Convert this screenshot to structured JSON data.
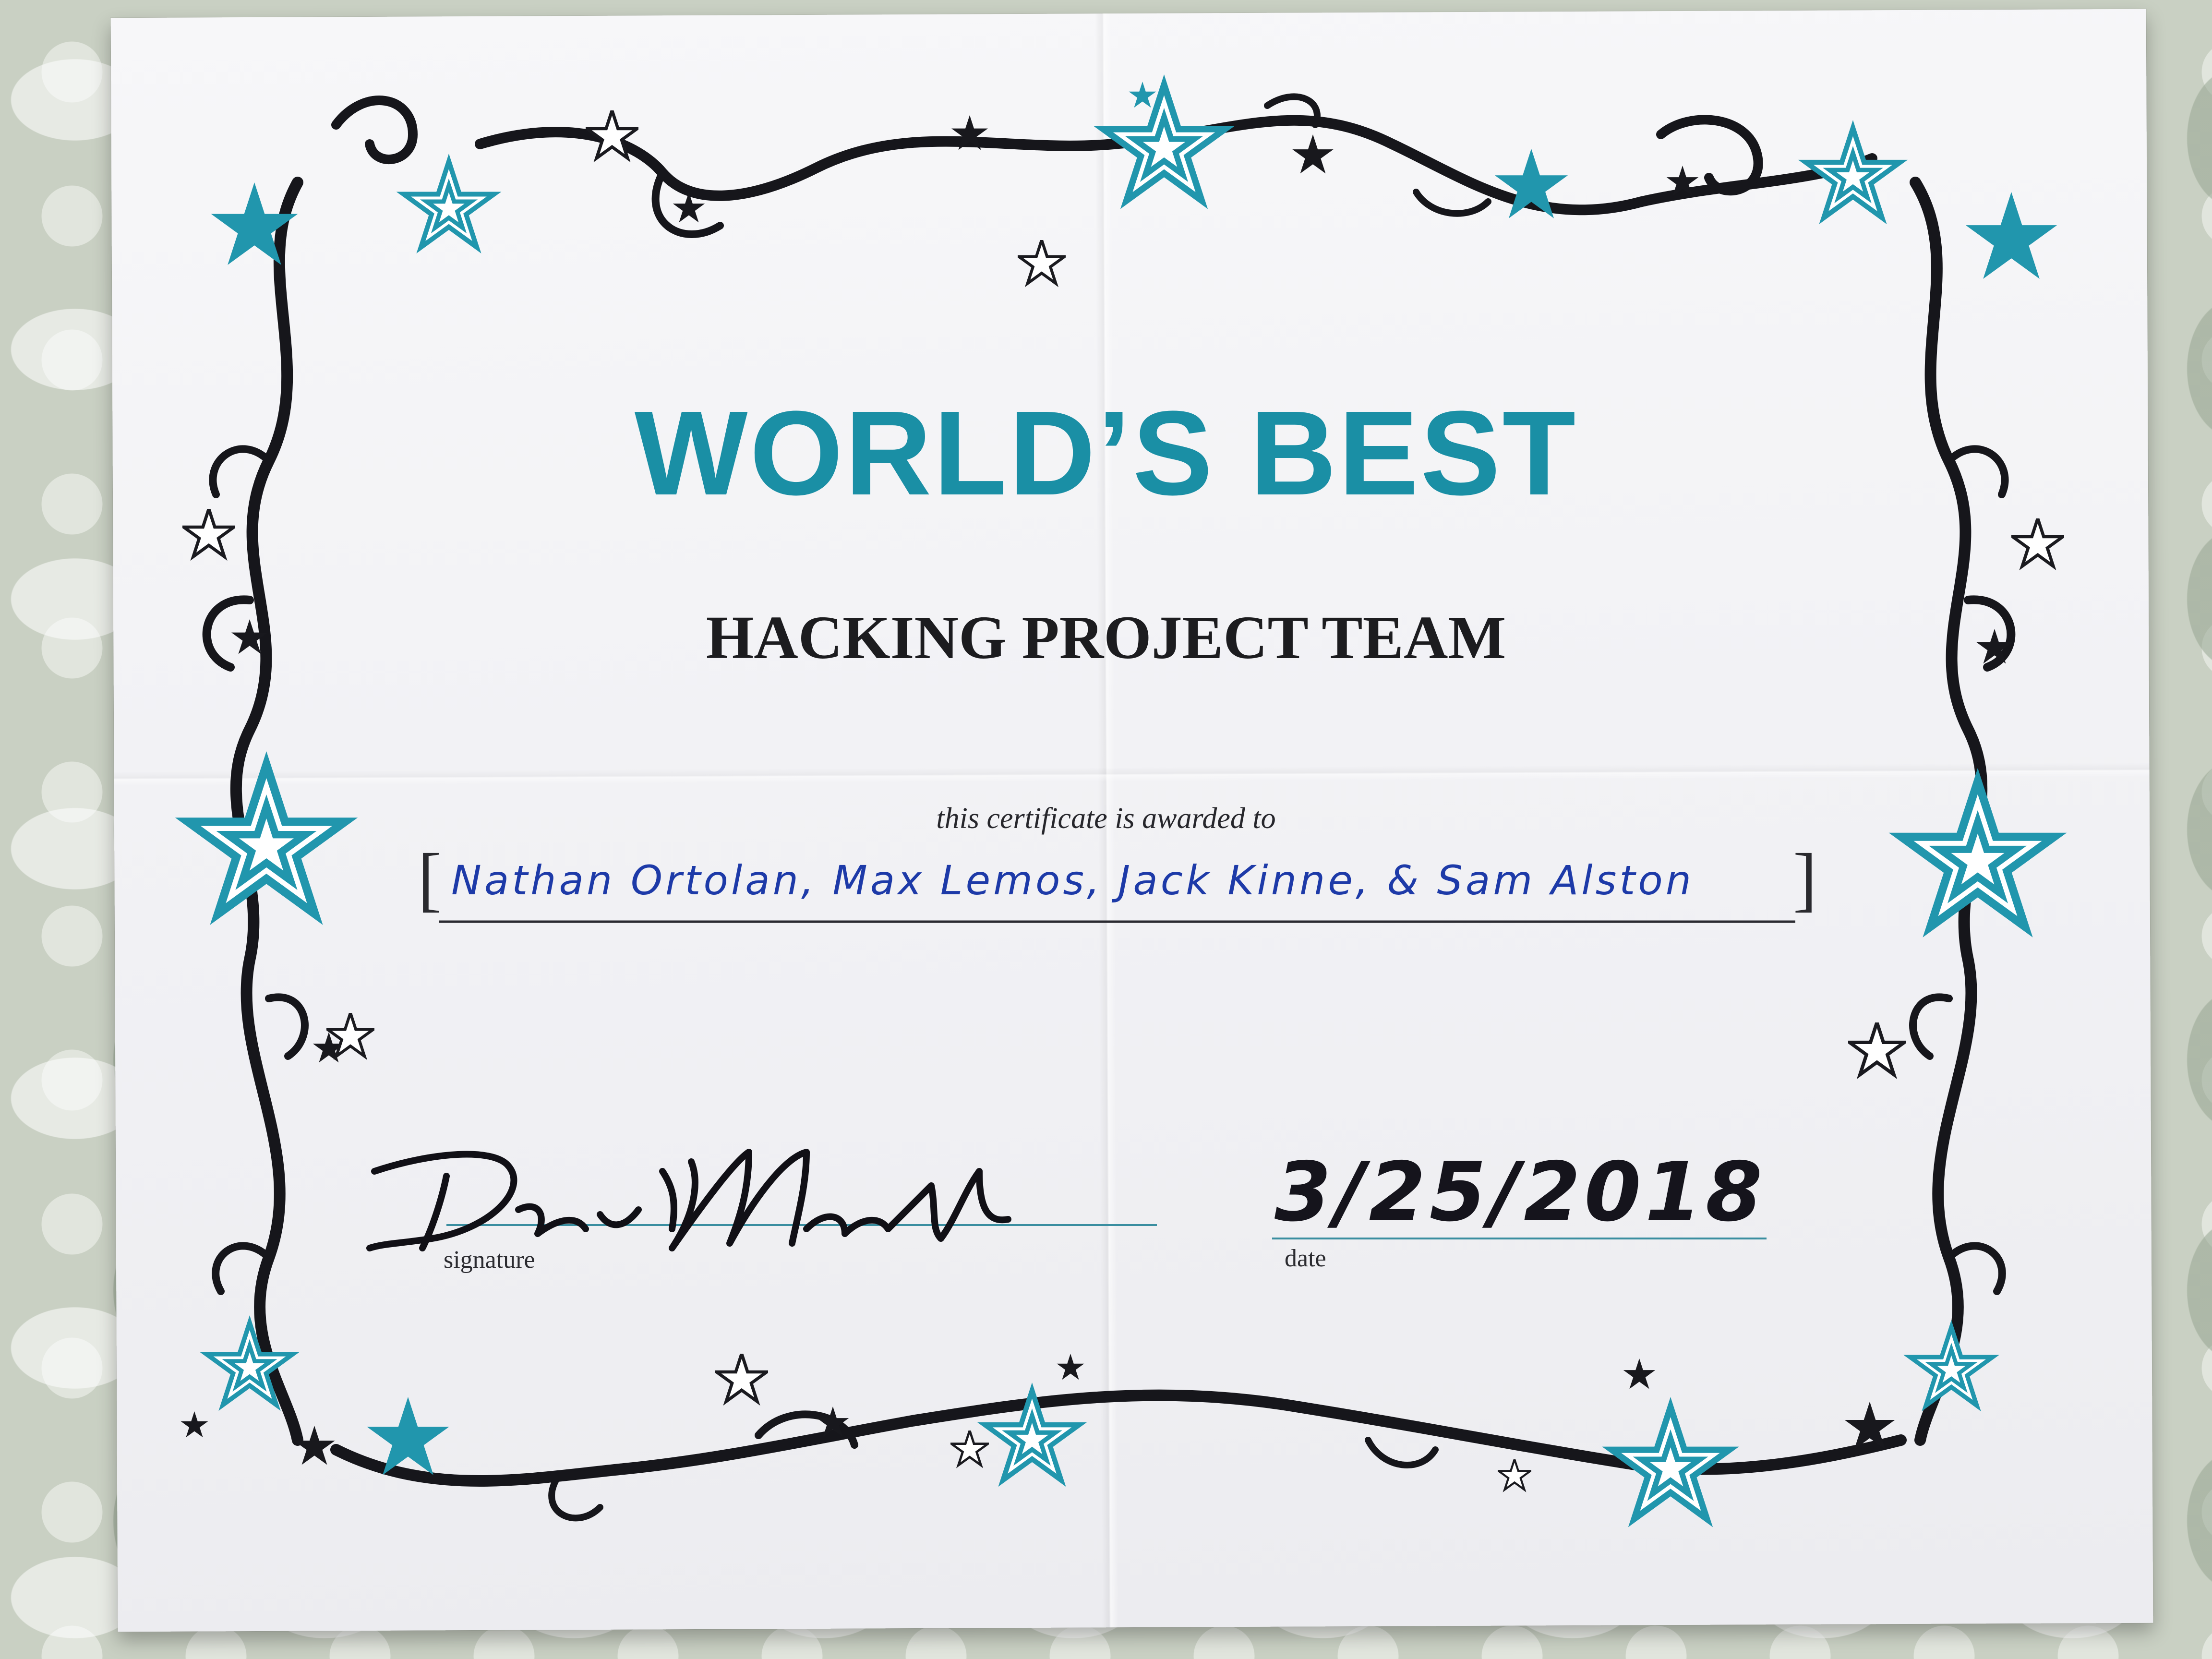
{
  "certificate": {
    "title": "WORLD’S BEST",
    "subtitle": "HACKING PROJECT TEAM",
    "awarded_line": "this certificate is awarded to",
    "recipients": "Nathan Ortolan, Max Lemos, Jack Kinne, & Sam Alston",
    "bracket_left": "[",
    "bracket_right": "]",
    "signature_caption": "signature",
    "date_caption": "date",
    "signature_handwritten": "David Madell",
    "date_handwritten": "3/25/2018"
  },
  "colors": {
    "accent_teal": "#1a8fa5",
    "ink_blue": "#1d3aa8",
    "ink_black": "#15141c",
    "paper": "#f2f2f5",
    "background_cloth": "#c9d0c3"
  }
}
